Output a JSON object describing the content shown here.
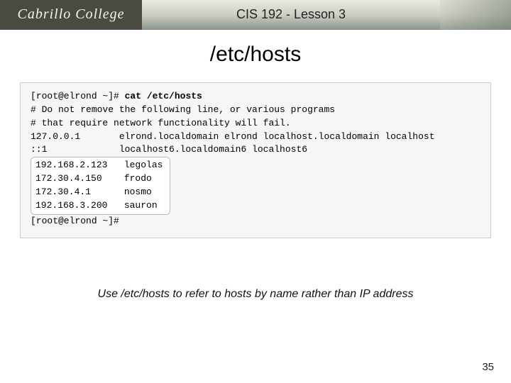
{
  "header": {
    "logo_text": "Cabrillo College",
    "lesson": "CIS 192 - Lesson 3"
  },
  "title": "/etc/hosts",
  "terminal": {
    "prompt1": "[root@elrond ~]# ",
    "command": "cat /etc/hosts",
    "line1": "# Do not remove the following line, or various programs",
    "line2": "# that require network functionality will fail.",
    "line3": "127.0.0.1       elrond.localdomain elrond localhost.localdomain localhost",
    "line4": "::1             localhost6.localdomain6 localhost6",
    "h1": "192.168.2.123   legolas",
    "h2": "172.30.4.150    frodo",
    "h3": "172.30.4.1      nosmo",
    "h4": "192.168.3.200   sauron",
    "prompt2": "[root@elrond ~]#"
  },
  "caption": "Use /etc/hosts to refer to hosts by name rather than IP address",
  "page_number": "35"
}
